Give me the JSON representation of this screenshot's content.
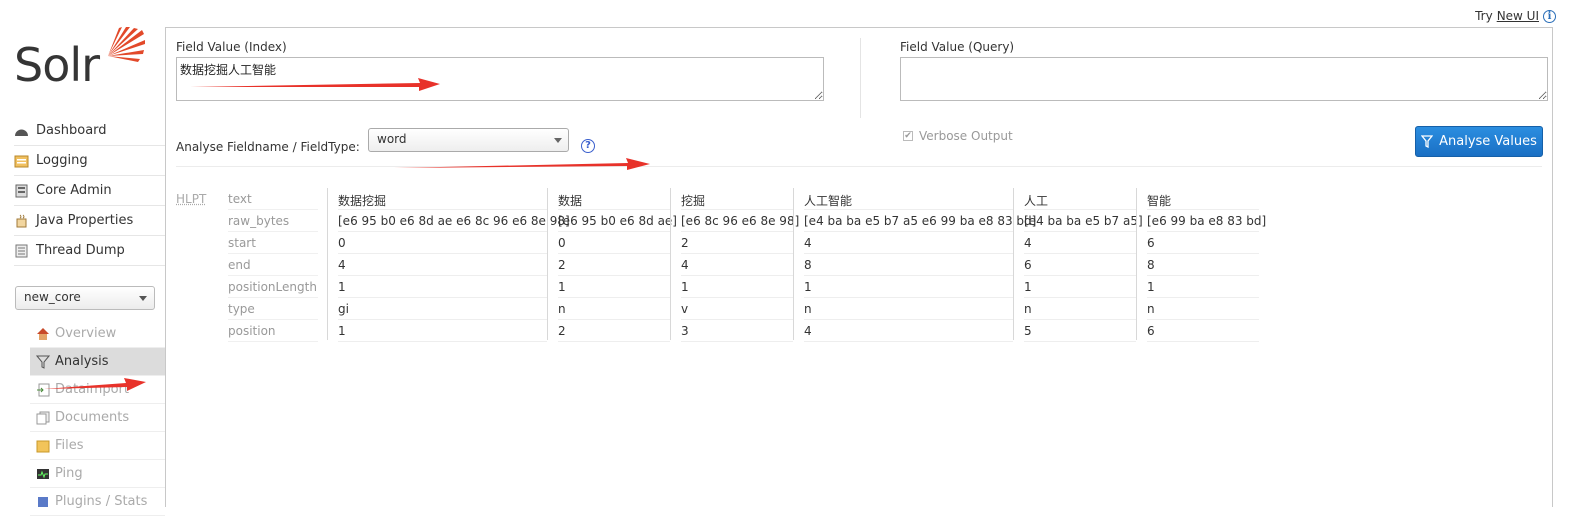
{
  "header": {
    "try_prefix": "Try",
    "new_ui_link": "New UI",
    "info_icon": "info-icon"
  },
  "logo": {
    "text": "Solr"
  },
  "nav": {
    "items": [
      {
        "label": "Dashboard",
        "icon": "dashboard-icon"
      },
      {
        "label": "Logging",
        "icon": "logging-icon"
      },
      {
        "label": "Core Admin",
        "icon": "core-admin-icon"
      },
      {
        "label": "Java Properties",
        "icon": "java-icon"
      },
      {
        "label": "Thread Dump",
        "icon": "thread-dump-icon"
      }
    ]
  },
  "core_selector": {
    "selected": "new_core"
  },
  "core_nav": {
    "items": [
      {
        "label": "Overview",
        "icon": "home-icon"
      },
      {
        "label": "Analysis",
        "icon": "funnel-icon"
      },
      {
        "label": "Dataimport",
        "icon": "dataimport-icon"
      },
      {
        "label": "Documents",
        "icon": "documents-icon"
      },
      {
        "label": "Files",
        "icon": "folder-icon"
      },
      {
        "label": "Ping",
        "icon": "ping-icon"
      },
      {
        "label": "Plugins / Stats",
        "icon": "plugins-icon"
      }
    ]
  },
  "analysis": {
    "index_label": "Field Value (Index)",
    "index_value": "数据挖掘人工智能",
    "query_label": "Field Value (Query)",
    "query_value": "",
    "fieldtype_label": "Analyse Fieldname / FieldType:",
    "fieldtype_value": "word",
    "verbose_label": "Verbose Output",
    "verbose_checked": true,
    "analyse_button": "Analyse Values",
    "tokenizer_abbr": "HLPT",
    "properties": [
      "text",
      "raw_bytes",
      "start",
      "end",
      "positionLength",
      "type",
      "position"
    ],
    "tokens": [
      [
        "数据挖掘",
        "[e6 95 b0 e6 8d ae e6 8c 96 e6 8e 98]",
        "0",
        "4",
        "1",
        "gi",
        "1"
      ],
      [
        "数据",
        "[e6 95 b0 e6 8d ae]",
        "0",
        "2",
        "1",
        "n",
        "2"
      ],
      [
        "挖掘",
        "[e6 8c 96 e6 8e 98]",
        "2",
        "4",
        "1",
        "v",
        "3"
      ],
      [
        "人工智能",
        "[e4 ba ba e5 b7 a5 e6 99 ba e8 83 bd]",
        "4",
        "8",
        "1",
        "n",
        "4"
      ],
      [
        "人工",
        "[e4 ba ba e5 b7 a5]",
        "4",
        "6",
        "1",
        "n",
        "5"
      ],
      [
        "智能",
        "[e6 99 ba e8 83 bd]",
        "6",
        "8",
        "1",
        "n",
        "6"
      ]
    ]
  },
  "colors": {
    "accent": "#1a6fc4",
    "arrow": "#e8322a",
    "logo_orange": "#e2492a"
  }
}
